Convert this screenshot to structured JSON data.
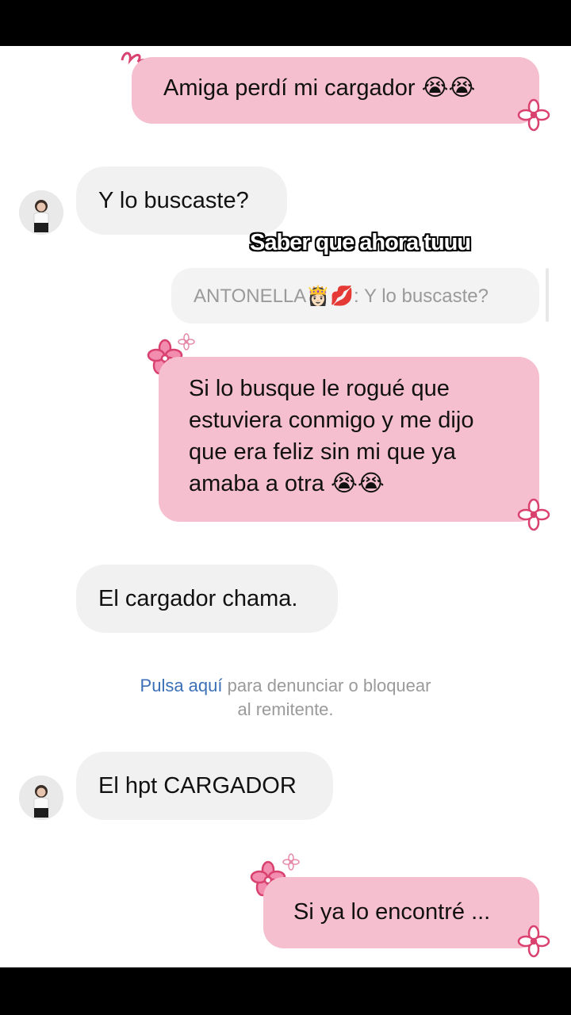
{
  "overlay": {
    "caption": "Saber que ahora tuuu"
  },
  "messages": [
    {
      "id": "m1",
      "direction": "sent",
      "text": "Amiga perdí mi cargador 😭😭"
    },
    {
      "id": "m2",
      "direction": "received",
      "text": "Y lo buscaste?"
    },
    {
      "id": "m3",
      "direction": "sent",
      "text": "Si lo busque le rogué que estuviera conmigo y me dijo que era feliz sin mi que ya amaba a otra 😭😭",
      "lines": [
        "Si lo busque le rogué que",
        "estuviera conmigo y me dijo",
        "que era feliz sin mi que ya",
        "amaba a otra 😭😭"
      ]
    },
    {
      "id": "m4",
      "direction": "received",
      "text": "El cargador chama."
    },
    {
      "id": "m5",
      "direction": "received",
      "text": "El hpt CARGADOR"
    },
    {
      "id": "m6",
      "direction": "sent",
      "text": "Si ya lo encontré ..."
    }
  ],
  "reply_preview": {
    "text": "ANTONELLA👸🏻💋: Y lo buscaste?"
  },
  "notice": {
    "link": "Pulsa aquí",
    "text_line1": " para denunciar o bloquear",
    "text_line2": "al remitente."
  },
  "colors": {
    "sent_bubble": "#f6bfd0",
    "received_bubble": "#f1f1f1",
    "flower": "#d9416f",
    "link": "#3b6fb6"
  }
}
